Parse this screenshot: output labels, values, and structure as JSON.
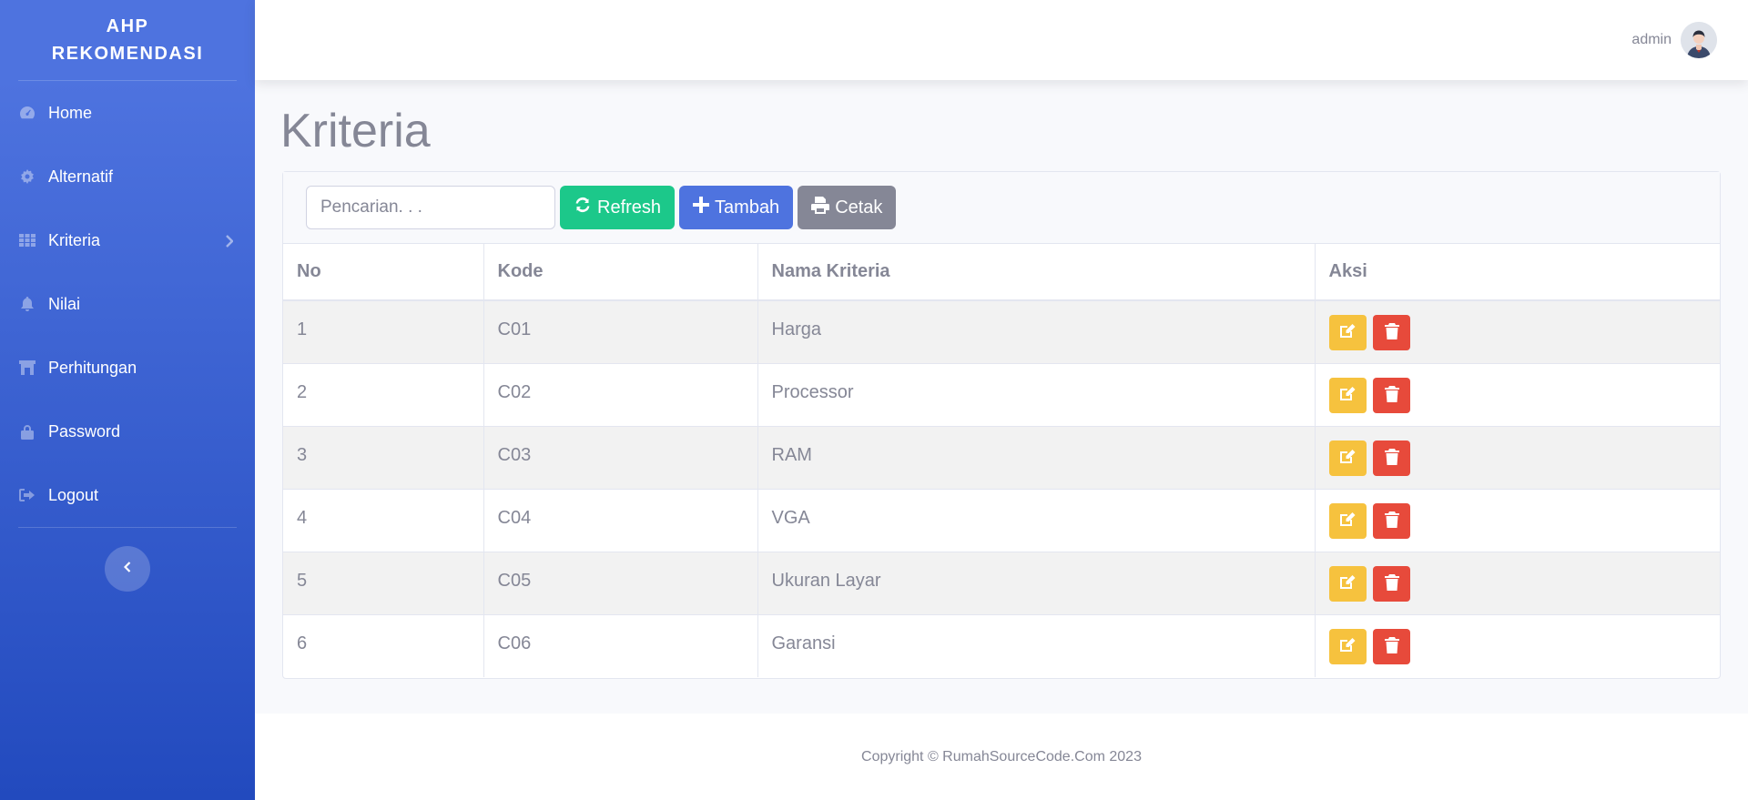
{
  "sidebar": {
    "brand_line1": "AHP",
    "brand_line2": "REKOMENDASI",
    "items": [
      {
        "label": "Home",
        "icon": "tachometer-icon"
      },
      {
        "label": "Alternatif",
        "icon": "cog-icon"
      },
      {
        "label": "Kriteria",
        "icon": "table-icon"
      },
      {
        "label": "Nilai",
        "icon": "bell-icon"
      },
      {
        "label": "Perhitungan",
        "icon": "building-icon"
      },
      {
        "label": "Password",
        "icon": "lock-icon"
      },
      {
        "label": "Logout",
        "icon": "sign-out-icon"
      }
    ]
  },
  "topbar": {
    "user_name": "admin"
  },
  "page": {
    "title": "Kriteria"
  },
  "toolbar": {
    "search_placeholder": "Pencarian. . .",
    "refresh_label": "Refresh",
    "add_label": "Tambah",
    "print_label": "Cetak"
  },
  "table": {
    "headers": [
      "No",
      "Kode",
      "Nama Kriteria",
      "Aksi"
    ],
    "rows": [
      {
        "no": "1",
        "kode": "C01",
        "nama": "Harga"
      },
      {
        "no": "2",
        "kode": "C02",
        "nama": "Processor"
      },
      {
        "no": "3",
        "kode": "C03",
        "nama": "RAM"
      },
      {
        "no": "4",
        "kode": "C04",
        "nama": "VGA"
      },
      {
        "no": "5",
        "kode": "C05",
        "nama": "Ukuran Layar"
      },
      {
        "no": "6",
        "kode": "C06",
        "nama": "Garansi"
      }
    ]
  },
  "footer": {
    "copyright": "Copyright © RumahSourceCode.Com 2023"
  },
  "colors": {
    "primary": "#4e73df",
    "success": "#1cc88a",
    "warning": "#f6c23e",
    "danger": "#e74a3b",
    "secondary": "#858796"
  }
}
